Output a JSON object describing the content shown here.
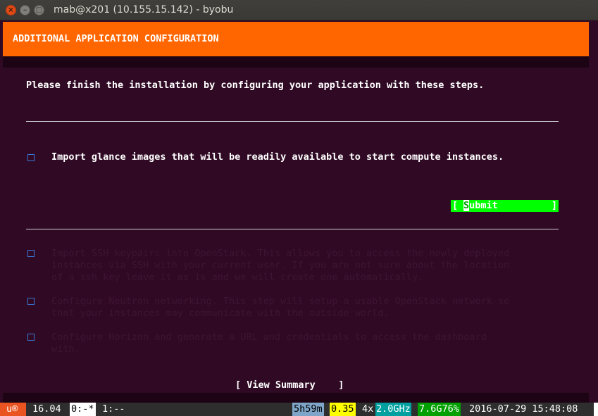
{
  "window": {
    "title": "mab@x201 (10.155.15.142) - byobu",
    "close_glyph": "×",
    "min_glyph": "–",
    "max_glyph": "□"
  },
  "dialog": {
    "header": "ADDITIONAL APPLICATION CONFIGURATION",
    "intro": "Please finish the installation by configuring your application with these steps.",
    "active_item": "Import glance images that will be readily available to start compute instances.",
    "submit": {
      "bracket_left": "[",
      "cursor_char": "S",
      "label_rest": "ubmit",
      "bracket_right": "]"
    },
    "inactive_items": [
      "Import SSH keypairs into OpenStack. This allows you to access the newly deployed\ninstances via SSH with your current user. If you are not sure about the location\nof a ssh key leave it as is and we will create one automatically.",
      "Configure Neutron networking. This step will setup a usable OpenStack network so\nthat your instances may communicate with the outside world.",
      "Configure Horizon and generate a URL and credentials to access the dashboard\nwith."
    ],
    "view_summary": "[ View Summary    ]"
  },
  "status": {
    "logo": "u®",
    "release": "16.04",
    "window0": "0:-*",
    "window1": "1:--",
    "uptime": "5h59m",
    "load": "0.35",
    "cpu_count": "4x",
    "cpu_freq": "2.0GHz",
    "mem": "7.6G76%",
    "datetime": "2016-07-29 15:48:08"
  },
  "colors": {
    "terminal_bg": "#300a24",
    "header_bg": "#ff6600",
    "submit_bg": "#00ff00",
    "checkbox": "#3a77d4",
    "ubuntu_orange": "#e95420"
  },
  "icons": {
    "checkbox": "checkbox-icon",
    "close": "close-icon",
    "minimize": "minimize-icon",
    "maximize": "maximize-icon"
  }
}
